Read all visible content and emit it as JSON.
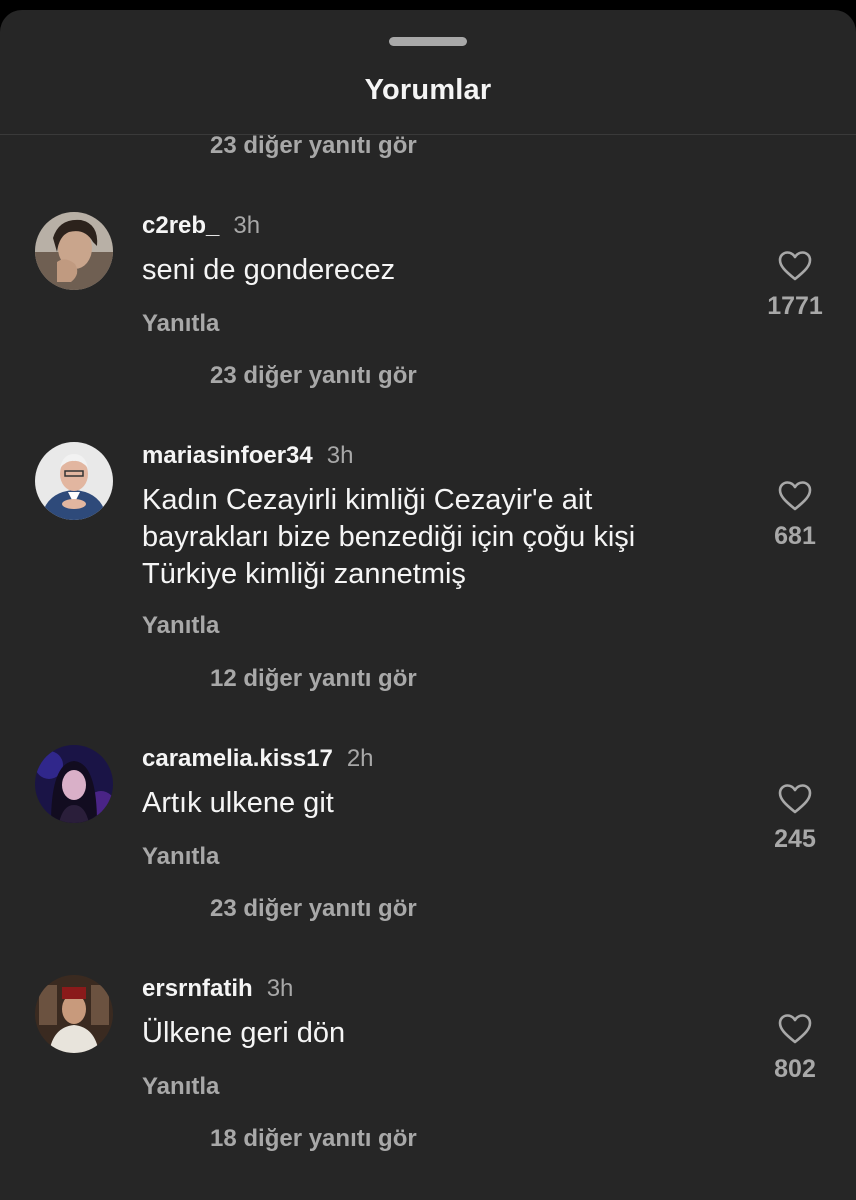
{
  "header": {
    "title": "Yorumlar"
  },
  "top_view_replies": "23 diğer yanıtı gör",
  "reply_label": "Yanıtla",
  "comments": [
    {
      "username": "c2reb_",
      "time": "3h",
      "text": "seni de gonderecez",
      "likes": "1771",
      "view_replies": "23 diğer yanıtı gör"
    },
    {
      "username": "mariasinfoer34",
      "time": "3h",
      "text": "Kadın Cezayirli kimliği Cezayir'e ait bayrakları bize benzediği için çoğu kişi Türkiye kimliği zannetmiş",
      "likes": "681",
      "view_replies": "12 diğer yanıtı gör"
    },
    {
      "username": "caramelia.kiss17",
      "time": "2h",
      "text": "Artık ulkene git",
      "likes": "245",
      "view_replies": "23 diğer yanıtı gör"
    },
    {
      "username": "ersrnfatih",
      "time": "3h",
      "text": "Ülkene geri dön",
      "likes": "802",
      "view_replies": "18 diğer yanıtı gör"
    }
  ],
  "colors": {
    "sheet": "#262626",
    "text": "#f5f5f5",
    "secondary": "#a8a8a8"
  },
  "icons": {
    "like": "heart-icon"
  }
}
